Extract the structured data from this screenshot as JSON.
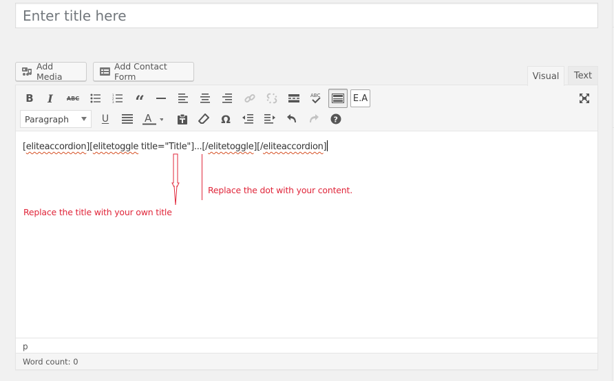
{
  "title_field": {
    "placeholder": "Enter title here",
    "value": ""
  },
  "media_buttons": {
    "add_media": "Add Media",
    "add_contact_form": "Add Contact Form"
  },
  "editor_tabs": [
    {
      "label": "Visual",
      "active": true
    },
    {
      "label": "Text",
      "active": false
    }
  ],
  "toolbar": {
    "row1": [
      "bold",
      "italic",
      "strikethrough",
      "bulleted-list",
      "numbered-list",
      "blockquote",
      "horizontal-line",
      "align-left",
      "align-center",
      "align-right",
      "insert-link",
      "remove-link",
      "read-more",
      "spellcheck",
      "toolbar-toggle",
      "elite-accordion"
    ],
    "row2": [
      "paragraph-format",
      "underline",
      "justify",
      "text-color",
      "paste-as-text",
      "clear-formatting",
      "special-character",
      "decrease-indent",
      "increase-indent",
      "undo",
      "redo",
      "keyboard-shortcuts"
    ],
    "format_select": "Paragraph",
    "ea_label": "E.A",
    "disabled": [
      "insert-link",
      "remove-link",
      "redo"
    ],
    "active": [
      "toolbar-toggle"
    ]
  },
  "content": {
    "parts": [
      {
        "text": "[",
        "misspelled": false
      },
      {
        "text": "eliteaccordion",
        "misspelled": true
      },
      {
        "text": "][",
        "misspelled": false
      },
      {
        "text": "elitetoggle",
        "misspelled": true
      },
      {
        "text": " title=\"Title\"]...[/",
        "misspelled": false
      },
      {
        "text": "elitetoggle",
        "misspelled": true
      },
      {
        "text": "][/",
        "misspelled": false
      },
      {
        "text": "eliteaccordion",
        "misspelled": true
      },
      {
        "text": "]",
        "misspelled": false
      }
    ]
  },
  "annotations": {
    "dot_note": "Replace the dot with your content.",
    "title_note": "Replace the title with your own title",
    "color": "#e0263a"
  },
  "statusbar": {
    "path": "p"
  },
  "word_count": "Word count: 0"
}
